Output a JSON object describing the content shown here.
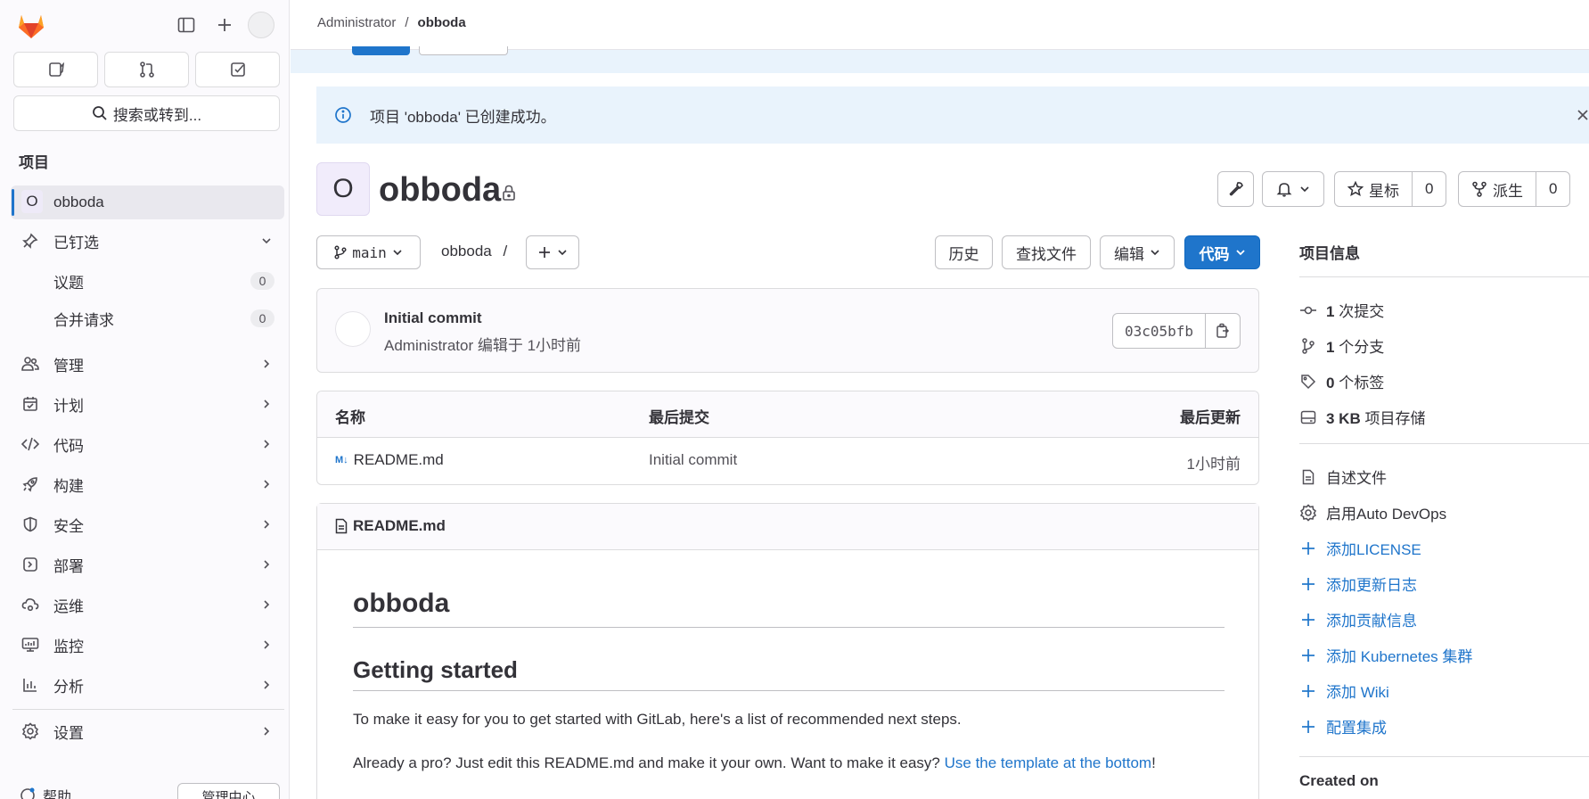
{
  "topbar": {
    "breadcrumb": [
      "Administrator",
      "obboda"
    ]
  },
  "sidebar": {
    "search_label": "搜索或转到...",
    "section_title": "项目",
    "project": {
      "initial": "O",
      "name": "obboda"
    },
    "pinned": {
      "label": "已钉选"
    },
    "pinned_items": [
      {
        "label": "议题",
        "count": "0"
      },
      {
        "label": "合并请求",
        "count": "0"
      }
    ],
    "items": [
      {
        "label": "管理",
        "icon": "users-icon"
      },
      {
        "label": "计划",
        "icon": "calendar-icon"
      },
      {
        "label": "代码",
        "icon": "code-icon"
      },
      {
        "label": "构建",
        "icon": "rocket-icon"
      },
      {
        "label": "安全",
        "icon": "shield-icon"
      },
      {
        "label": "部署",
        "icon": "deploy-icon"
      },
      {
        "label": "运维",
        "icon": "cloud-gear-icon"
      },
      {
        "label": "监控",
        "icon": "monitor-icon"
      },
      {
        "label": "分析",
        "icon": "chart-icon"
      },
      {
        "label": "设置",
        "icon": "gear-icon"
      }
    ],
    "help_label": "帮助",
    "admin_label": "管理中心"
  },
  "alert": {
    "text": "项目 'obboda' 已创建成功。"
  },
  "project": {
    "initial": "O",
    "name": "obboda",
    "star_label": "星标",
    "star_count": "0",
    "fork_label": "派生",
    "fork_count": "0"
  },
  "toolbar": {
    "branch": "main",
    "path": "obboda",
    "path_sep": "/",
    "history": "历史",
    "find_file": "查找文件",
    "edit": "编辑",
    "code": "代码"
  },
  "commit": {
    "title": "Initial commit",
    "author": "Administrator",
    "meta": "编辑于 1小时前",
    "sha": "03c05bfb"
  },
  "file_table": {
    "headers": [
      "名称",
      "最后提交",
      "最后更新"
    ],
    "rows": [
      {
        "name": "README.md",
        "last_commit": "Initial commit",
        "updated": "1小时前"
      }
    ]
  },
  "readme": {
    "filename": "README.md",
    "h1": "obboda",
    "h2": "Getting started",
    "p1": "To make it easy for you to get started with GitLab, here's a list of recommended next steps.",
    "p2_prefix": "Already a pro? Just edit this README.md and make it your own. Want to make it easy? ",
    "p2_link": "Use the template at the bottom",
    "p2_suffix": "!"
  },
  "right_panel": {
    "title": "项目信息",
    "stats": [
      {
        "value": "1",
        "label": "次提交",
        "icon": "commit-icon"
      },
      {
        "value": "1",
        "label": "个分支",
        "icon": "branch-icon"
      },
      {
        "value": "0",
        "label": "个标签",
        "icon": "tag-icon"
      },
      {
        "value": "3 KB",
        "label": "项目存储",
        "icon": "storage-icon"
      }
    ],
    "readme_label": "自述文件",
    "autodevops_label": "启用Auto DevOps",
    "add_links": [
      "添加LICENSE",
      "添加更新日志",
      "添加贡献信息",
      "添加 Kubernetes 集群",
      "添加 Wiki",
      "配置集成"
    ],
    "created_on_label": "Created on"
  },
  "colors": {
    "primary": "#1f75cb",
    "alert_bg": "#e9f3fc",
    "sidebar_bg": "#fbfafd"
  }
}
